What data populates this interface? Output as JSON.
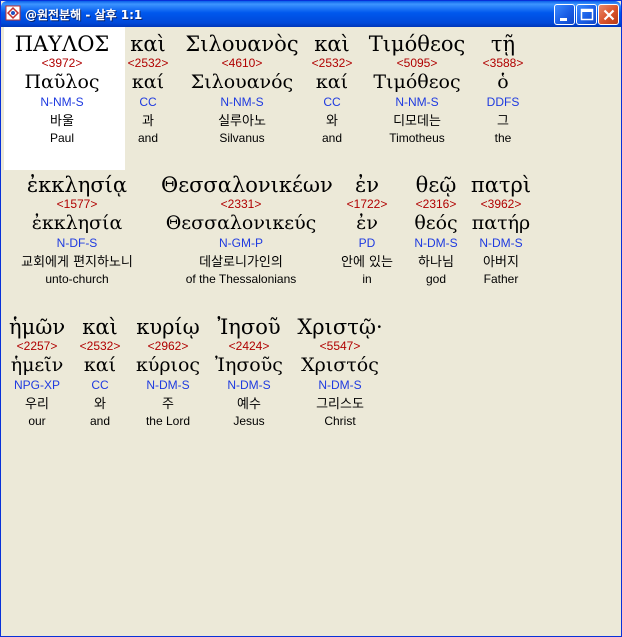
{
  "window": {
    "title": "@원전분해 - 살후 1:1",
    "icon": "app-icon",
    "buttons": [
      "minimize-icon",
      "maximize-icon",
      "close-icon"
    ]
  },
  "colors": {
    "strongs": "#B00000",
    "parsing": "#1E3AE0",
    "titlebar": "#0058EE"
  },
  "rows": [
    {
      "words": [
        {
          "greek": "ΠΑΥΛΟΣ",
          "strongs": "<3972>",
          "lemma": "Παῦλος",
          "parsing": "N-NM-S",
          "korean": "바울",
          "english": "Paul"
        },
        {
          "greek": "καὶ",
          "strongs": "<2532>",
          "lemma": "καί",
          "parsing": "CC",
          "korean": "과",
          "english": "and"
        },
        {
          "greek": "Σιλουανὸς",
          "strongs": "<4610>",
          "lemma": "Σιλουανός",
          "parsing": "N-NM-S",
          "korean": "실루아노",
          "english": "Silvanus"
        },
        {
          "greek": "καὶ",
          "strongs": "<2532>",
          "lemma": "καί",
          "parsing": "CC",
          "korean": "와",
          "english": "and"
        },
        {
          "greek": "Τιμόθεος",
          "strongs": "<5095>",
          "lemma": "Τιμόθεος",
          "parsing": "N-NM-S",
          "korean": "디모데는",
          "english": "Timotheus"
        },
        {
          "greek": "τῇ",
          "strongs": "<3588>",
          "lemma": "ὁ",
          "parsing": "DDFS",
          "korean": "그",
          "english": "the"
        }
      ]
    },
    {
      "words": [
        {
          "greek": "ἐκκλησίᾳ",
          "strongs": "<1577>",
          "lemma": "ἐκκλησία",
          "parsing": "N-DF-S",
          "korean": "교회에게 편지하노니",
          "english": "unto-church"
        },
        {
          "greek": "Θεσσαλονικέων",
          "strongs": "<2331>",
          "lemma": "Θεσσαλονικεύς",
          "parsing": "N-GM-P",
          "korean": "데살로니가인의",
          "english": "of the Thessalonians"
        },
        {
          "greek": "ἐν",
          "strongs": "<1722>",
          "lemma": "ἐν",
          "parsing": "PD",
          "korean": "안에 있는",
          "english": "in"
        },
        {
          "greek": "θεῷ",
          "strongs": "<2316>",
          "lemma": "θεός",
          "parsing": "N-DM-S",
          "korean": "하나님",
          "english": "god"
        },
        {
          "greek": "πατρὶ",
          "strongs": "<3962>",
          "lemma": "πατήρ",
          "parsing": "N-DM-S",
          "korean": "아버지",
          "english": "Father"
        }
      ]
    },
    {
      "words": [
        {
          "greek": "ἡμῶν",
          "strongs": "<2257>",
          "lemma": "ἡμεῖν",
          "parsing": "NPG-XP",
          "korean": "우리",
          "english": "our"
        },
        {
          "greek": "καὶ",
          "strongs": "<2532>",
          "lemma": "καί",
          "parsing": "CC",
          "korean": "와",
          "english": "and"
        },
        {
          "greek": "κυρίῳ",
          "strongs": "<2962>",
          "lemma": "κύριος",
          "parsing": "N-DM-S",
          "korean": "주",
          "english": "the Lord"
        },
        {
          "greek": "Ἰησοῦ",
          "strongs": "<2424>",
          "lemma": "Ἰησοῦς",
          "parsing": "N-DM-S",
          "korean": "예수",
          "english": "Jesus"
        },
        {
          "greek": "Χριστῷ·",
          "strongs": "<5547>",
          "lemma": "Χριστός",
          "parsing": "N-DM-S",
          "korean": "그리스도",
          "english": "Christ"
        }
      ]
    }
  ]
}
